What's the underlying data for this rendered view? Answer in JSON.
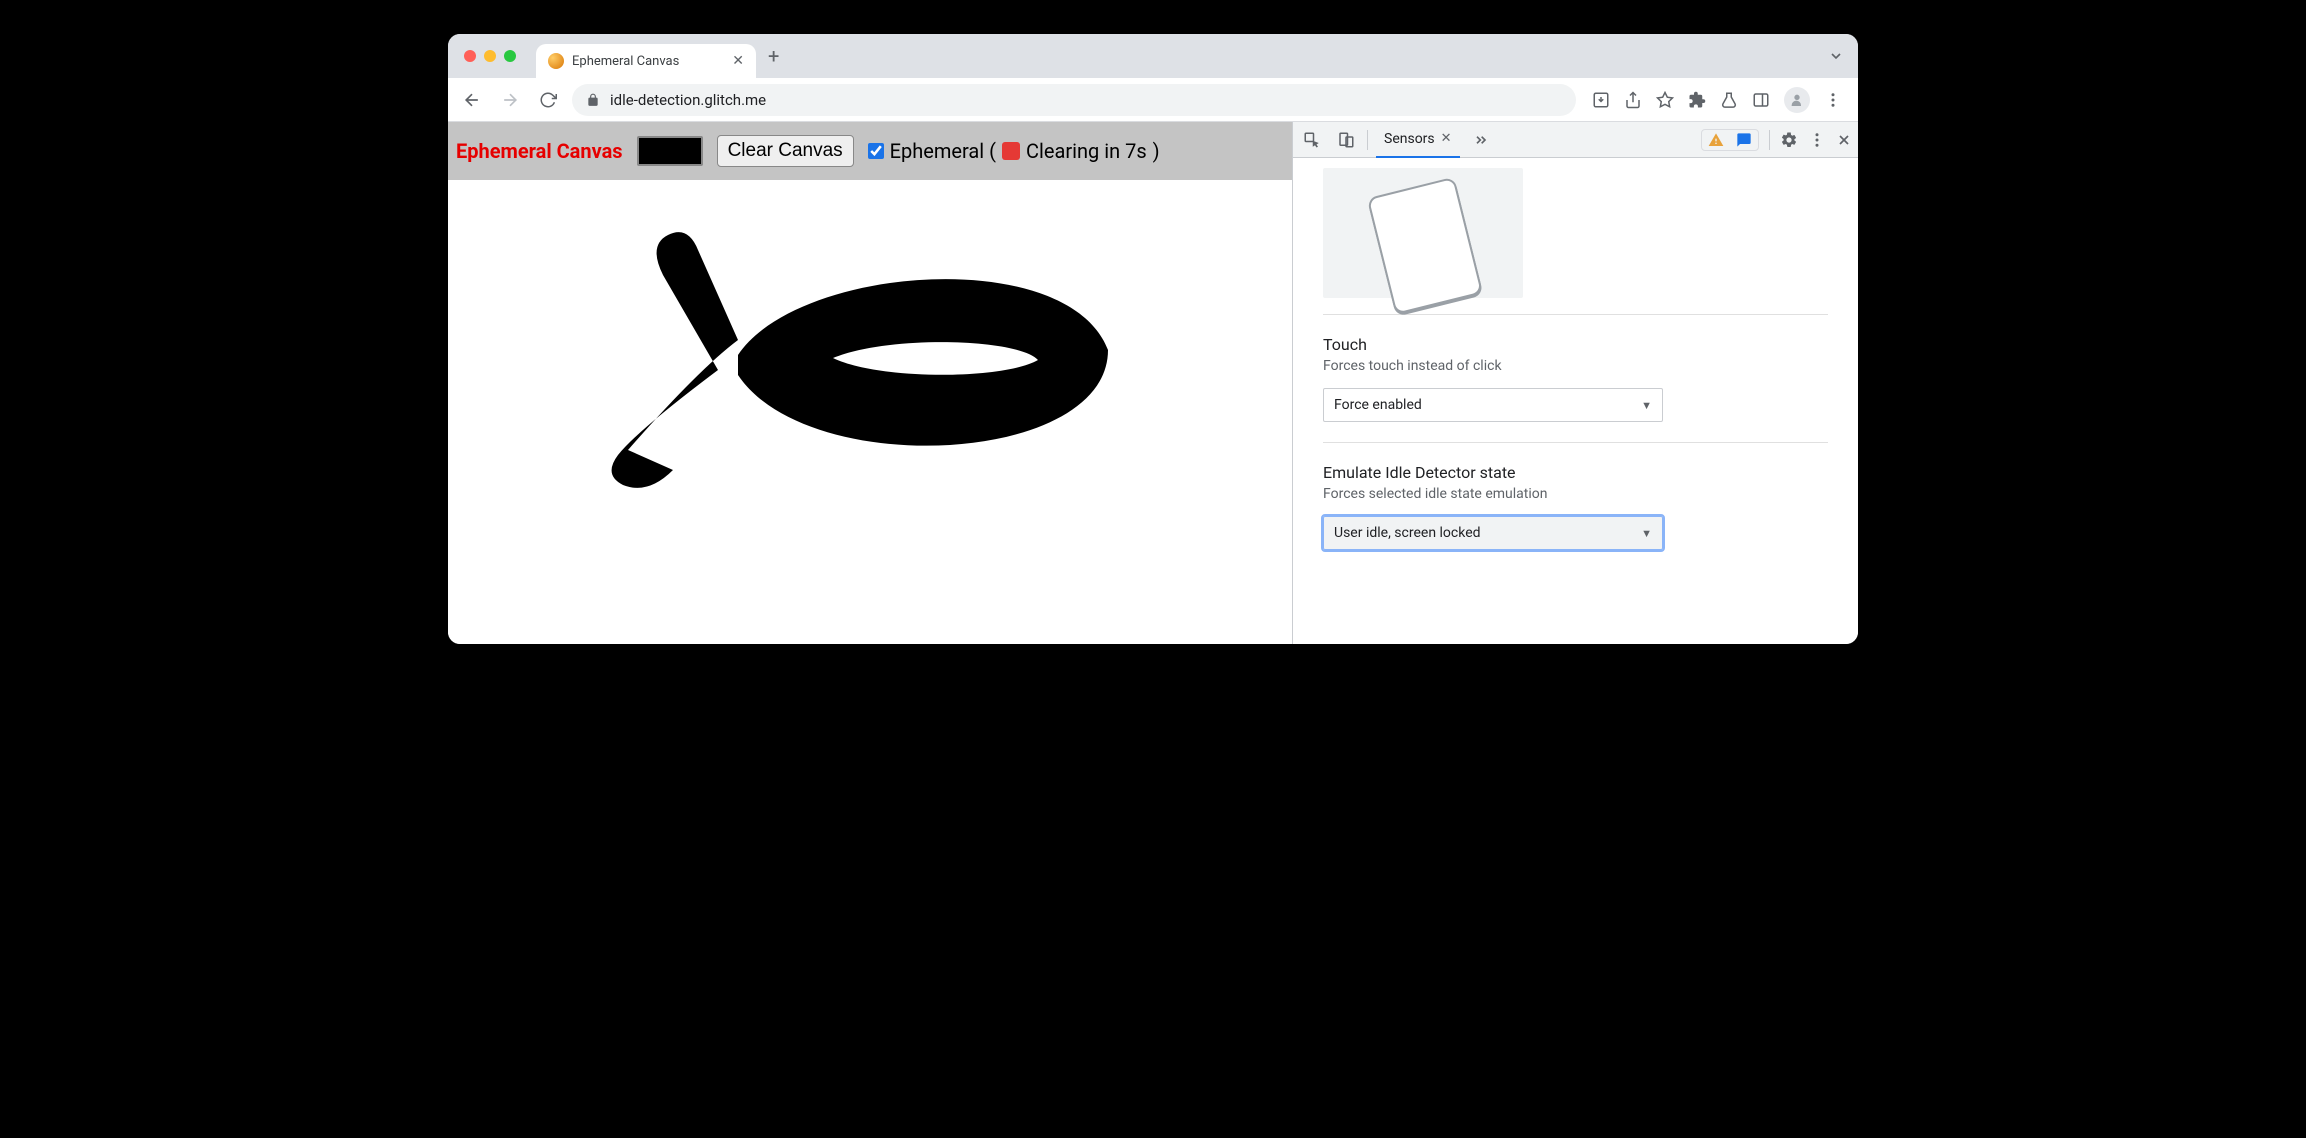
{
  "browser": {
    "tab_title": "Ephemeral Canvas",
    "url": "idle-detection.glitch.me"
  },
  "app": {
    "title": "Ephemeral Canvas",
    "clear_button": "Clear Canvas",
    "ephemeral_checked": true,
    "ephemeral_label_prefix": "Ephemeral (",
    "ephemeral_countdown": "Clearing in 7s",
    "ephemeral_label_suffix": ")",
    "color_swatch": "#000000"
  },
  "devtools": {
    "active_tab": "Sensors",
    "sections": {
      "touch": {
        "title": "Touch",
        "subtitle": "Forces touch instead of click",
        "value": "Force enabled"
      },
      "idle": {
        "title": "Emulate Idle Detector state",
        "subtitle": "Forces selected idle state emulation",
        "value": "User idle, screen locked"
      }
    }
  }
}
